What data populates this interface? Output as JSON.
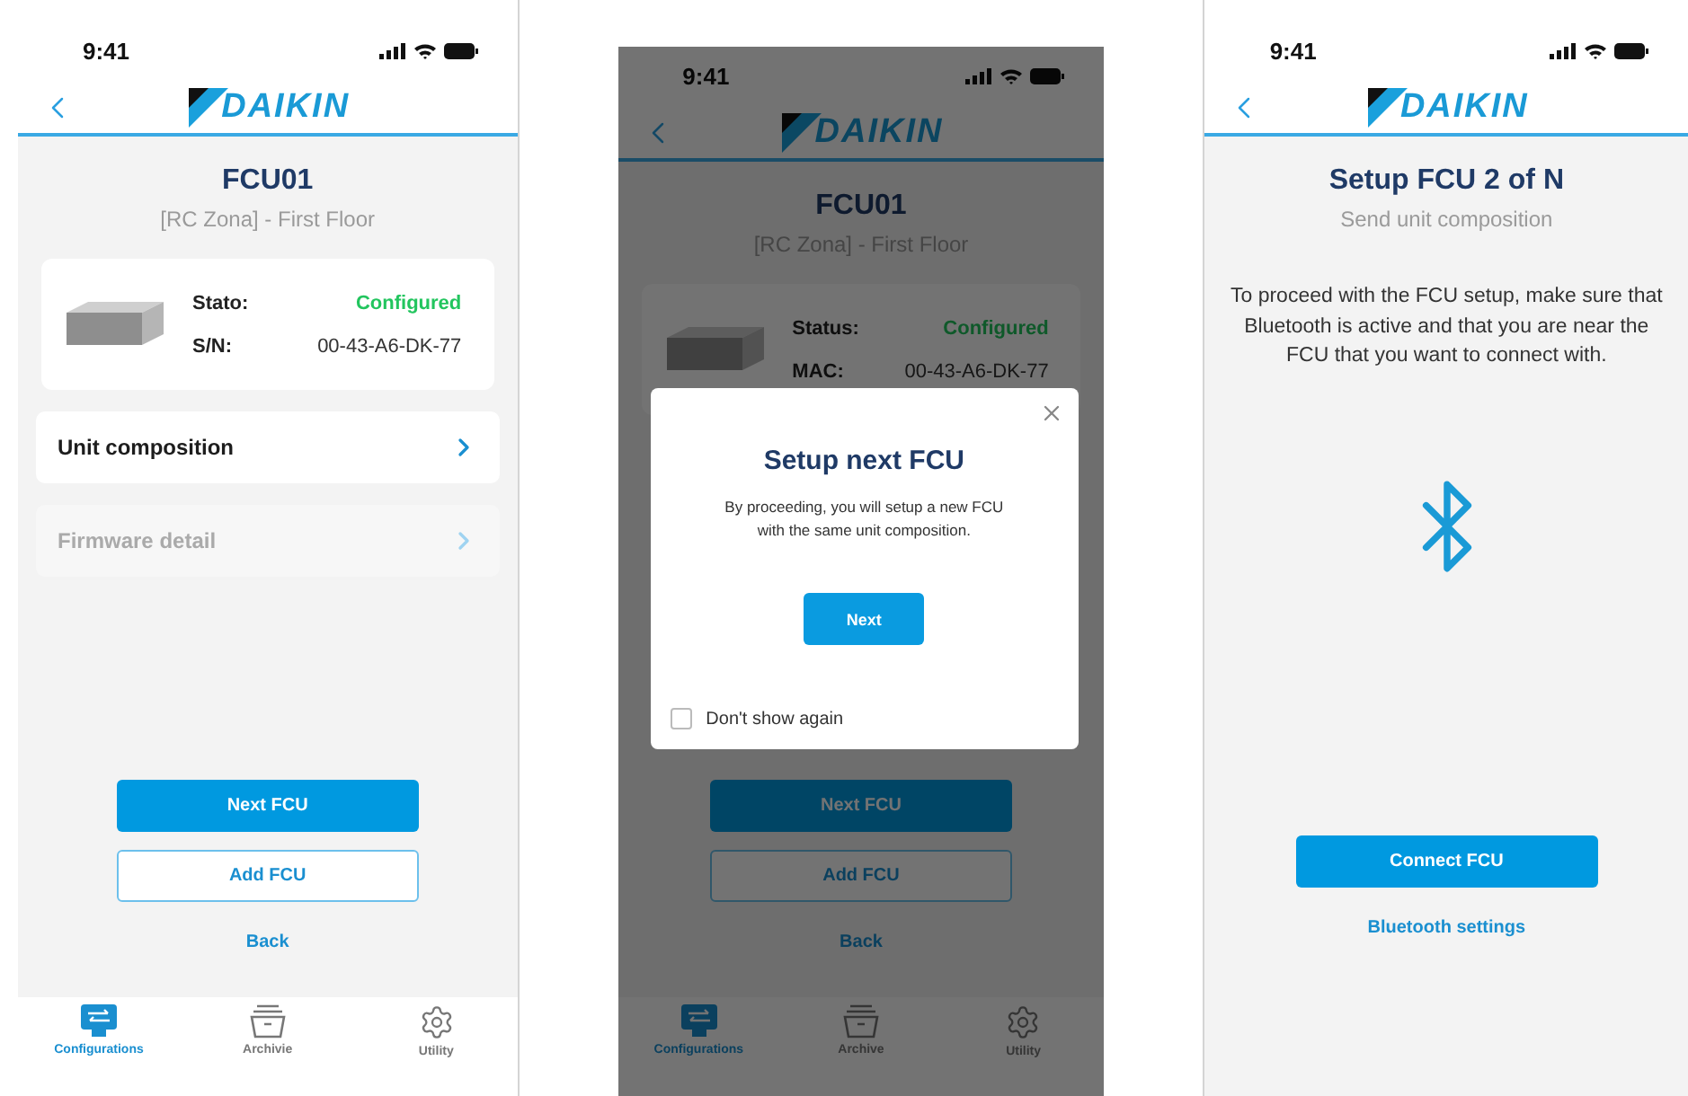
{
  "screens": [
    {
      "kind": "unit_detail",
      "status_bar": {
        "time": "9:41"
      },
      "header": {
        "logo": "DAIKIN"
      },
      "title": "FCU01",
      "subtitle": "[RC Zona] - First Floor",
      "card": {
        "rows": [
          {
            "kind": "status",
            "label": "Stato:",
            "value": "Configured"
          },
          {
            "kind": "text",
            "label": "S/N:",
            "value": "00-43-A6-DK-77"
          }
        ]
      },
      "menu": [
        {
          "label": "Unit composition",
          "disabled": false
        },
        {
          "label": "Firmware detail",
          "disabled": true
        }
      ],
      "buttons": [
        {
          "kind": "primary",
          "label": "Next FCU"
        },
        {
          "kind": "outline",
          "label": "Add FCU"
        },
        {
          "kind": "link",
          "label": "Back"
        }
      ],
      "tab_bar": [
        {
          "kind": "configurations",
          "label": "Configurations",
          "selected": true
        },
        {
          "kind": "archive",
          "label": "Archivie",
          "selected": false
        },
        {
          "kind": "utility",
          "label": "Utility",
          "selected": false
        }
      ]
    },
    {
      "kind": "unit_detail",
      "status_bar": {
        "time": "9:41"
      },
      "header": {
        "logo": "DAIKIN"
      },
      "title": "FCU01",
      "subtitle": "[RC Zona] - First Floor",
      "card": {
        "rows": [
          {
            "kind": "status",
            "label": "Status:",
            "value": "Configured"
          },
          {
            "kind": "text",
            "label": "MAC:",
            "value": "00-43-A6-DK-77"
          }
        ]
      },
      "buttons": [
        {
          "kind": "primary",
          "label": "Next FCU"
        },
        {
          "kind": "outline",
          "label": "Add FCU"
        },
        {
          "kind": "link",
          "label": "Back"
        }
      ],
      "tab_bar": [
        {
          "kind": "configurations",
          "label": "Configurations",
          "selected": true
        },
        {
          "kind": "archive",
          "label": "Archive",
          "selected": false
        },
        {
          "kind": "utility",
          "label": "Utility",
          "selected": false
        }
      ],
      "dialog": {
        "title": "Setup next FCU",
        "message": "By proceeding, you will setup a new FCU with the same unit composition.",
        "button": "Next",
        "checkbox": {
          "label": "Don't show again",
          "checked": false
        }
      }
    },
    {
      "kind": "connect",
      "status_bar": {
        "time": "9:41"
      },
      "header": {
        "logo": "DAIKIN"
      },
      "title": "Setup FCU 2 of N",
      "subtitle": "Send unit composition",
      "message": "To proceed with the FCU setup, make sure that Bluetooth is active and that you are near the FCU that you want to connect with.",
      "buttons": [
        {
          "kind": "primary",
          "label": "Connect FCU"
        },
        {
          "kind": "link",
          "label": "Bluetooth settings"
        }
      ]
    }
  ]
}
